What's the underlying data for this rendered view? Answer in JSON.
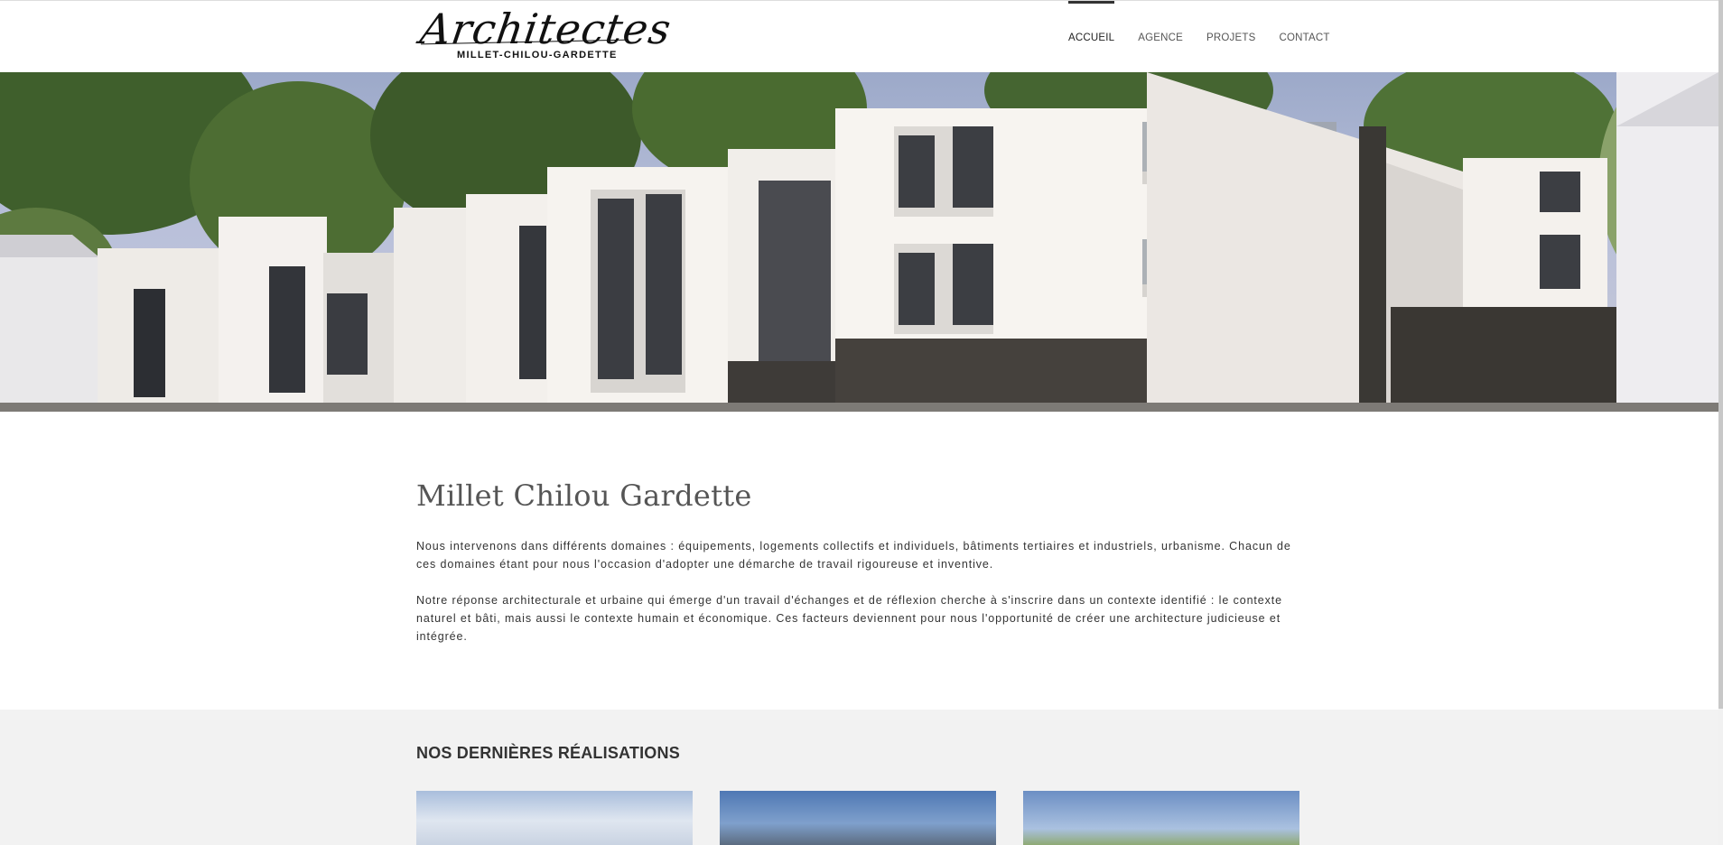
{
  "logo": {
    "script": "Architectes",
    "subtitle": "MILLET-CHILOU-GARDETTE"
  },
  "nav": {
    "items": [
      {
        "label": "ACCUEIL",
        "active": true
      },
      {
        "label": "AGENCE",
        "active": false
      },
      {
        "label": "PROJETS",
        "active": false
      },
      {
        "label": "CONTACT",
        "active": false
      }
    ]
  },
  "intro": {
    "title": "Millet Chilou Gardette",
    "paragraph1": "Nous intervenons dans différents domaines : équipements, logements collectifs et individuels, bâtiments tertiaires et industriels, urbanisme. Chacun de ces domaines étant pour nous l'occasion d'adopter une démarche de travail rigoureuse et inventive.",
    "paragraph2": "Notre réponse architecturale et urbaine qui émerge d'un travail d'échanges et de réflexion cherche à s'inscrire dans un contexte identifié : le contexte naturel et bâti, mais aussi le contexte humain et économique. Ces facteurs deviennent pour nous l'opportunité de créer une architecture judicieuse et intégrée."
  },
  "recent": {
    "title": "NOS DERNIÈRES RÉALISATIONS"
  },
  "colors": {
    "background": "#ffffff",
    "section_grey": "#f2f2f2",
    "text": "#333333",
    "nav_active_bar": "#333333"
  }
}
